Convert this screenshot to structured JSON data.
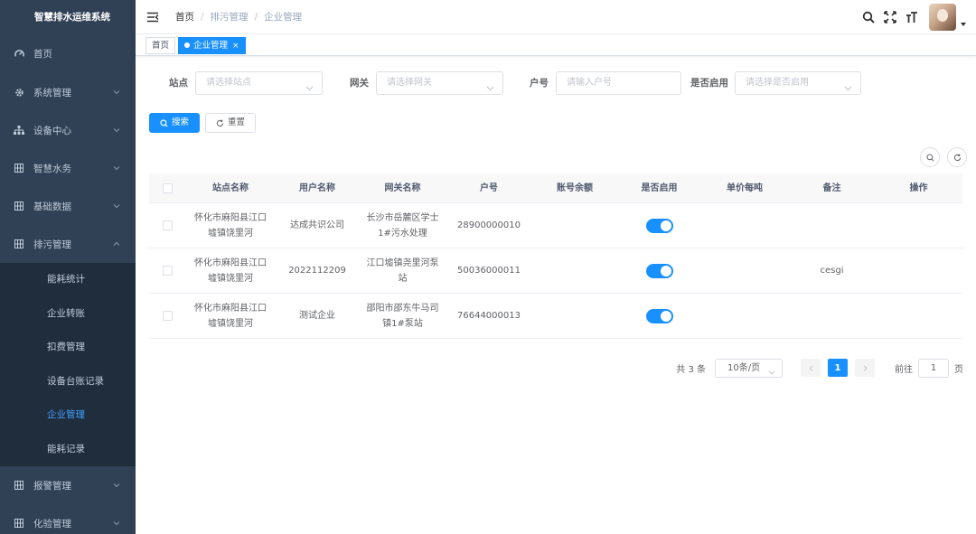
{
  "app": {
    "title": "智慧排水运维系统"
  },
  "sidebar": {
    "items": [
      {
        "label": "首页",
        "icon": "dashboard-icon"
      },
      {
        "label": "系统管理",
        "icon": "gear-icon"
      },
      {
        "label": "设备中心",
        "icon": "tree-icon"
      },
      {
        "label": "智慧水务",
        "icon": "grid-icon"
      },
      {
        "label": "基础数据",
        "icon": "grid-icon"
      },
      {
        "label": "排污管理",
        "icon": "grid-icon"
      }
    ],
    "submenu": [
      {
        "label": "能耗统计"
      },
      {
        "label": "企业转账"
      },
      {
        "label": "扣费管理"
      },
      {
        "label": "设备台账记录"
      },
      {
        "label": "企业管理",
        "active": true
      },
      {
        "label": "能耗记录"
      }
    ],
    "bottom_items": [
      {
        "label": "报警管理",
        "icon": "grid-icon"
      },
      {
        "label": "化验管理",
        "icon": "grid-icon"
      }
    ]
  },
  "breadcrumb": {
    "home": "首页",
    "sep": "/",
    "level2": "排污管理",
    "level3": "企业管理"
  },
  "tags": {
    "home": "首页",
    "current": "企业管理",
    "close": "×"
  },
  "filters": {
    "site": {
      "label": "站点",
      "placeholder": "请选择站点"
    },
    "gateway": {
      "label": "网关",
      "placeholder": "请选择网关"
    },
    "account": {
      "label": "户号",
      "placeholder": "请输入户号"
    },
    "enabled": {
      "label": "是否启用",
      "placeholder": "请选择是否启用"
    }
  },
  "buttons": {
    "search": "搜索",
    "reset": "重置"
  },
  "table": {
    "headers": [
      "站点名称",
      "用户名称",
      "网关名称",
      "户号",
      "账号余额",
      "是否启用",
      "单价每吨",
      "备注",
      "操作"
    ],
    "rows": [
      {
        "site": "怀化市麻阳县江口墟镇饶里河",
        "user": "达成共识公司",
        "gateway": "长沙市岳麓区学士1#污水处理",
        "account": "28900000010",
        "balance": "",
        "enabled": true,
        "price": "",
        "note": ""
      },
      {
        "site": "怀化市麻阳县江口墟镇饶里河",
        "user": "2022112209",
        "gateway": "江口墟镇尧里河泵站",
        "account": "50036000011",
        "balance": "",
        "enabled": true,
        "price": "",
        "note": "cesgi"
      },
      {
        "site": "怀化市麻阳县江口墟镇饶里河",
        "user": "测试企业",
        "gateway": "邵阳市邵东牛马司镇1#泵站",
        "account": "76644000013",
        "balance": "",
        "enabled": true,
        "price": "",
        "note": ""
      }
    ]
  },
  "pagination": {
    "total": "共 3 条",
    "page_size": "10条/页",
    "current": "1",
    "goto_prefix": "前往",
    "goto_value": "1",
    "goto_suffix": "页"
  },
  "colors": {
    "sidebar_bg": "#304156",
    "submenu_bg": "#1f2d3d",
    "primary": "#1890ff",
    "active_text": "#409eff"
  }
}
